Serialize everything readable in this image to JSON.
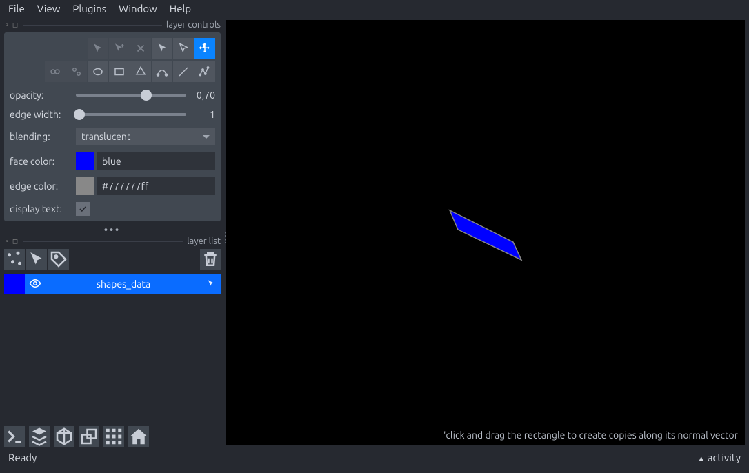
{
  "menu": {
    "file": "File",
    "view": "View",
    "plugins": "Plugins",
    "window": "Window",
    "help": "Help"
  },
  "panels": {
    "layer_controls": "layer controls",
    "layer_list": "layer list"
  },
  "props": {
    "opacity_label": "opacity:",
    "opacity_value": "0,70",
    "opacity_pct": 64,
    "edge_width_label": "edge width:",
    "edge_width_value": "1",
    "edge_width_pct": 3,
    "blending_label": "blending:",
    "blending_value": "translucent",
    "face_color_label": "face color:",
    "face_color_swatch": "#0000ff",
    "face_color_text": "blue",
    "edge_color_label": "edge color:",
    "edge_color_swatch": "#888888",
    "edge_color_text": "#777777ff",
    "display_text_label": "display text:",
    "display_text_checked": "✓"
  },
  "layer": {
    "name": "shapes_data"
  },
  "viewport": {
    "hint": "'click and drag the rectangle to create copies along its normal vector"
  },
  "status": {
    "ready": "Ready",
    "activity": "activity"
  }
}
